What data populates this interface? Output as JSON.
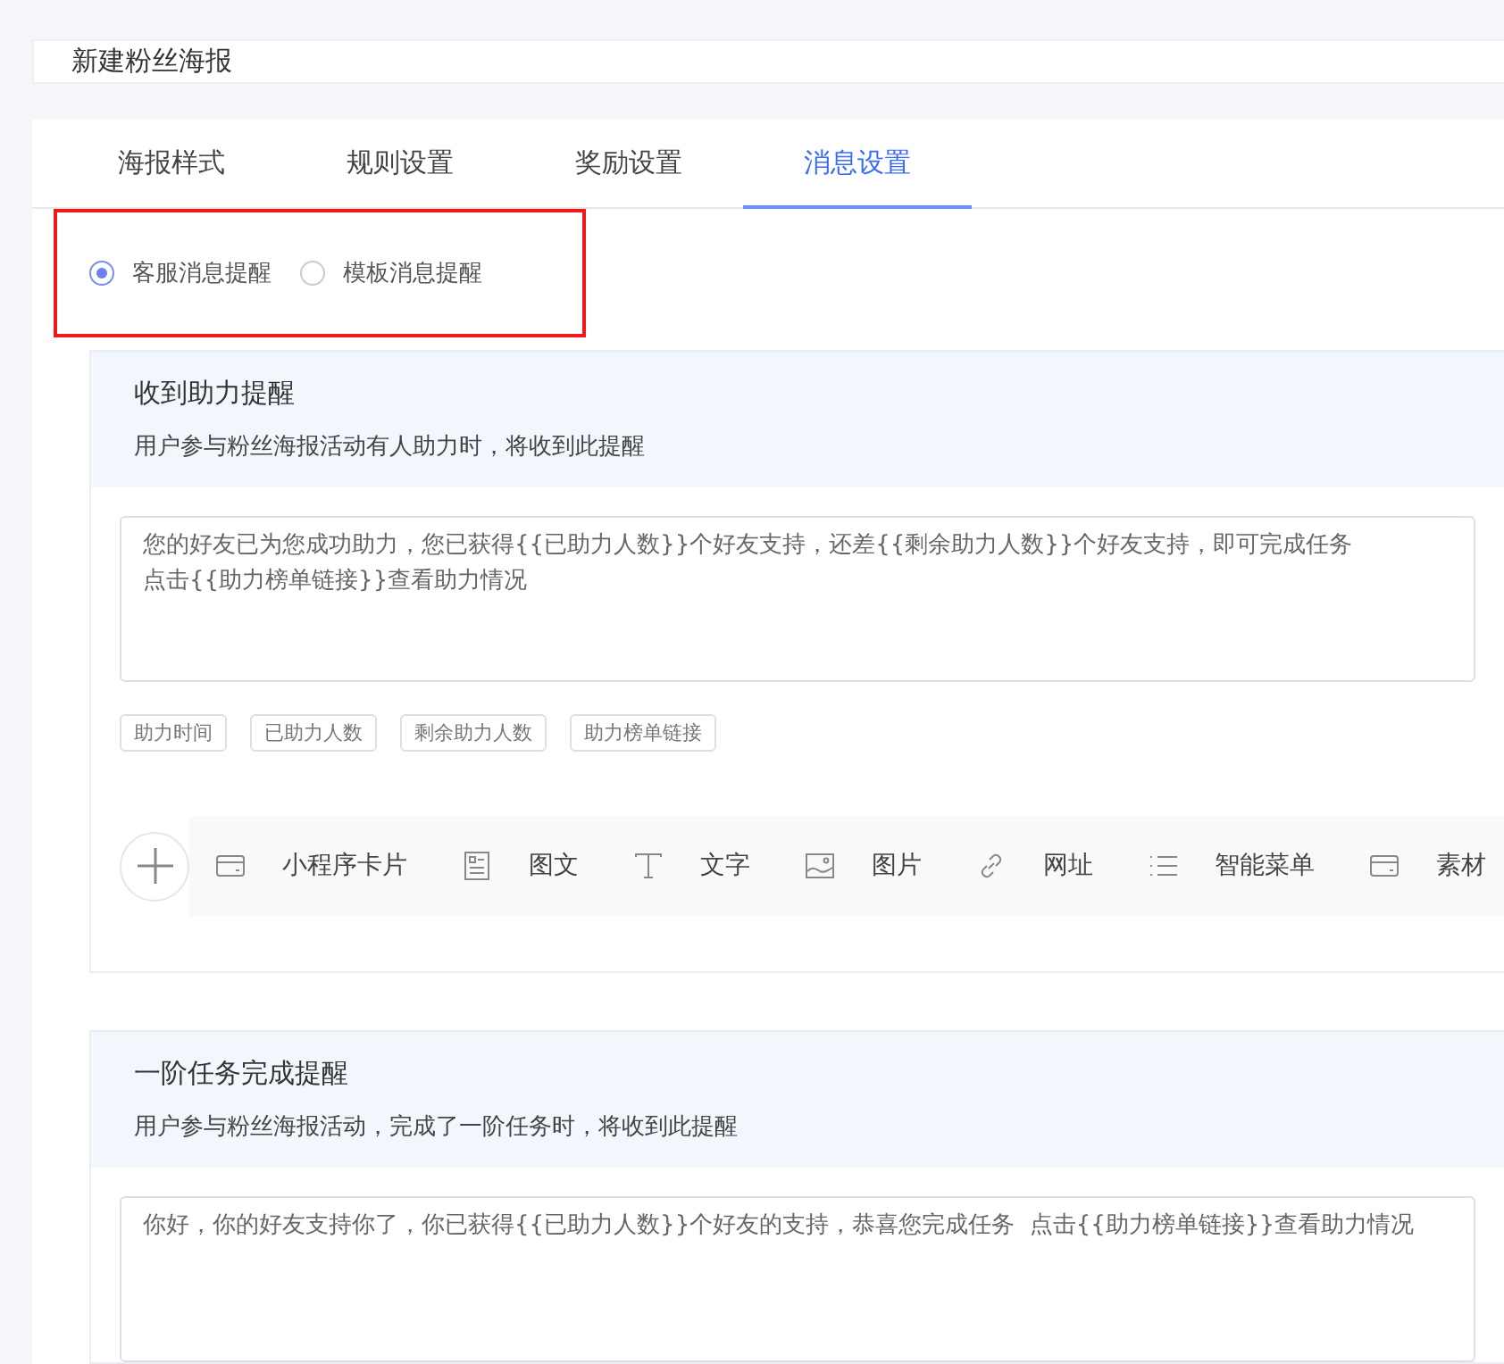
{
  "page_title": "新建粉丝海报",
  "tabs": [
    {
      "label": "海报样式",
      "selected": false
    },
    {
      "label": "规则设置",
      "selected": false
    },
    {
      "label": "奖励设置",
      "selected": false
    },
    {
      "label": "消息设置",
      "selected": true
    }
  ],
  "reminder_types": [
    {
      "label": "客服消息提醒",
      "selected": true
    },
    {
      "label": "模板消息提醒",
      "selected": false
    }
  ],
  "sections": [
    {
      "title": "收到助力提醒",
      "description": "用户参与粉丝海报活动有人助力时，将收到此提醒",
      "message_lines": [
        "您的好友已为您成功助力，您已获得{{已助力人数}}个好友支持，还差{{剩余助力人数}}个好友支持，即可完成任务",
        "点击{{助力榜单链接}}查看助力情况"
      ],
      "variables": [
        "助力时间",
        "已助力人数",
        "剩余助力人数",
        "助力榜单链接"
      ],
      "toolbar": [
        {
          "kind": "card",
          "label": "小程序卡片"
        },
        {
          "kind": "article",
          "label": "图文"
        },
        {
          "kind": "text",
          "label": "文字"
        },
        {
          "kind": "image",
          "label": "图片"
        },
        {
          "kind": "link",
          "label": "网址"
        },
        {
          "kind": "menu",
          "label": "智能菜单"
        },
        {
          "kind": "card",
          "label": "素材"
        }
      ]
    },
    {
      "title": "一阶任务完成提醒",
      "description": "用户参与粉丝海报活动，完成了一阶任务时，将收到此提醒",
      "message_lines": [
        "你好，你的好友支持你了，你已获得{{已助力人数}}个好友的支持，恭喜您完成任务  点击{{助力榜单链接}}查看助力情况"
      ]
    }
  ]
}
